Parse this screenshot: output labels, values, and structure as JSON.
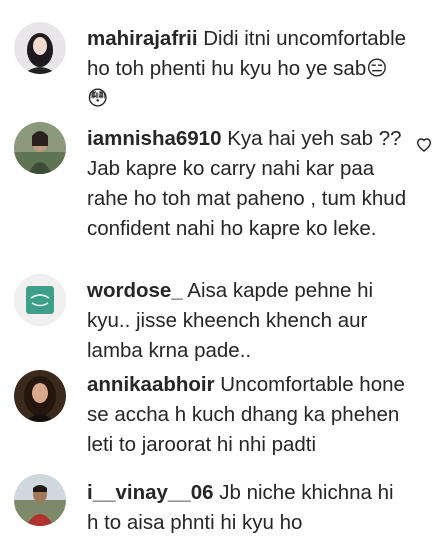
{
  "comments": [
    {
      "username": "mahirajafrii",
      "text": "Didi itni uncomfortable ho toh phenti hu kyu ho ye sab😑😳",
      "avatar_icon": "profile-photo-avatar"
    },
    {
      "username": "iamnisha6910",
      "text": "Kya hai yeh sab ?? Jab kapre ko carry nahi kar paa rahe ho toh mat paheno , tum khud confident nahi ho kapre ko leke.",
      "avatar_icon": "profile-photo-avatar"
    },
    {
      "username": "wordose_",
      "text": "Aisa kapde pehne hi kyu.. jisse kheench khench aur lamba krna pade..",
      "avatar_icon": "brand-logo-avatar"
    },
    {
      "username": "annikaabhoir",
      "text": "Uncomfortable hone se accha h kuch dhang ka phehen leti to jaroorat hi nhi padti",
      "avatar_icon": "profile-photo-avatar"
    },
    {
      "username": "i__vinay__06",
      "text": "Jb niche khichna hi h to aisa phnti hi kyu ho",
      "avatar_icon": "profile-photo-avatar"
    }
  ],
  "colors": {
    "text": "#262626",
    "heart": "#262626",
    "background": "#ffffff"
  }
}
